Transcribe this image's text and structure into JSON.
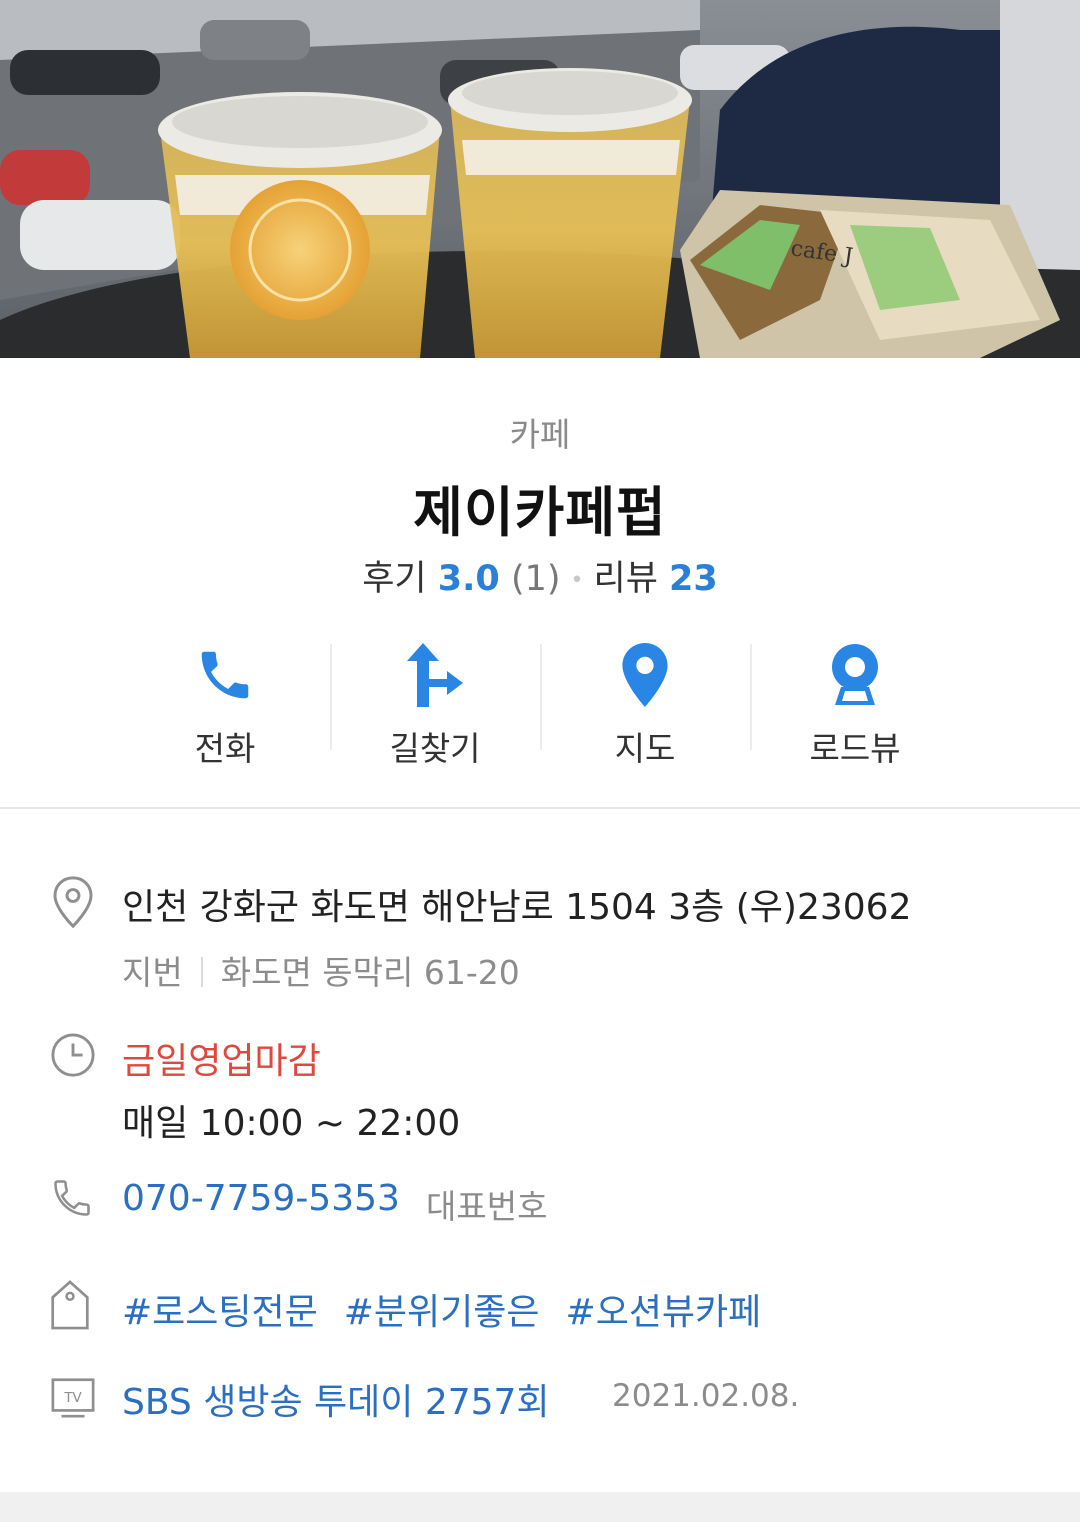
{
  "photo": {
    "label": "cafe J"
  },
  "place": {
    "category": "카페",
    "name": "제이카페펍",
    "review_label": "후기",
    "review_score": "3.0",
    "review_count": "(1)",
    "blog_label": "리뷰",
    "blog_count": "23"
  },
  "actions": [
    {
      "label": "전화",
      "icon": "phone-icon"
    },
    {
      "label": "길찾기",
      "icon": "directions-icon"
    },
    {
      "label": "지도",
      "icon": "map-pin-icon"
    },
    {
      "label": "로드뷰",
      "icon": "roadview-camera-icon"
    }
  ],
  "info": {
    "address": "인천 강화군 화도면 해안남로 1504 3층 (우)23062",
    "lot_label": "지번",
    "lot_address": "화도면 동막리 61-20",
    "hours_status": "금일영업마감",
    "hours": "매일 10:00 ~ 22:00",
    "phone": "070-7759-5353",
    "phone_label": "대표번호",
    "tags": [
      "#로스팅전문",
      "#분위기좋은",
      "#오션뷰카페"
    ],
    "tv_program": "SBS 생방송 투데이 2757회",
    "tv_date": "2021.02.08."
  },
  "colors": {
    "accent_blue": "#2a7fd8",
    "link_blue": "#2a6fc0",
    "closed_red": "#e0473f",
    "muted_gray": "#8c8c8c"
  }
}
